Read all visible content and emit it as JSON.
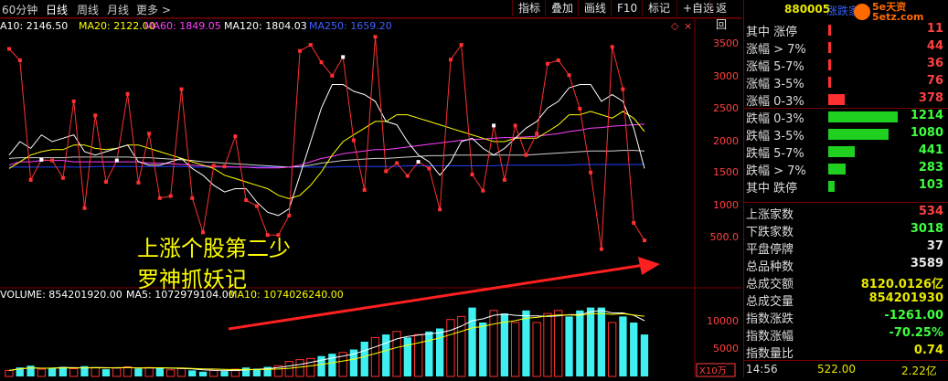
{
  "toolbar": {
    "tabs": [
      "60分钟",
      "日线",
      "周线",
      "月线",
      "更多 >"
    ],
    "active_tab": "日线",
    "buttons": [
      "指标",
      "叠加",
      "画线",
      "F10",
      "标记",
      "+自选",
      "返回"
    ]
  },
  "ma_legend": {
    "ma10": "A10: 2146.50",
    "ma20": "MA20: 2122.00",
    "ma60": "MA60: 1849.05",
    "ma120": "MA120: 1804.03",
    "ma250": "MA250: 1659.20",
    "colors": {
      "ma10": "#ffffff",
      "ma20": "#ffff00",
      "ma60": "#ff40ff",
      "ma120": "#ffffff",
      "ma250": "#2040ff"
    }
  },
  "vol_legend": {
    "volume": "VOLUME: 854201920.00",
    "ma5": "MA5: 1072979104.00",
    "ma10": "MA10: 1074026240.00"
  },
  "price_axis": [
    "3500",
    "3000",
    "2500",
    "2000",
    "1500",
    "1000",
    "500.0"
  ],
  "vol_axis": [
    "10000",
    "5000"
  ],
  "vol_unit": "X10万",
  "overlay": {
    "line1": "上涨个股第二少",
    "line2": "罗神抓妖记"
  },
  "right_panel": {
    "code": "880005",
    "name": "涨跌家数",
    "logo": "5e天资 5etz.com",
    "rows": [
      {
        "label": "其中 涨停",
        "value": "11",
        "color": "#ff3030",
        "bar": 0.005
      },
      {
        "label": "涨幅 > 7%",
        "value": "44",
        "color": "#ff3030",
        "bar": 0.01
      },
      {
        "label": "涨幅 5-7%",
        "value": "36",
        "color": "#ff3030",
        "bar": 0.01
      },
      {
        "label": "涨幅 3-5%",
        "value": "76",
        "color": "#ff3030",
        "bar": 0.015
      },
      {
        "label": "涨幅 0-3%",
        "value": "378",
        "color": "#ff3030",
        "bar": 0.22
      },
      {
        "label": "跌幅 0-3%",
        "value": "1214",
        "color": "#20d020",
        "bar": 0.95
      },
      {
        "label": "跌幅 3-5%",
        "value": "1080",
        "color": "#20d020",
        "bar": 0.82
      },
      {
        "label": "跌幅 5-7%",
        "value": "441",
        "color": "#20d020",
        "bar": 0.36
      },
      {
        "label": "跌幅 > 7%",
        "value": "283",
        "color": "#20d020",
        "bar": 0.24
      },
      {
        "label": "其中 跌停",
        "value": "103",
        "color": "#20d020",
        "bar": 0.09
      }
    ],
    "stats": [
      {
        "label": "上涨家数",
        "value": "534",
        "cls": "red"
      },
      {
        "label": "下跌家数",
        "value": "3018",
        "cls": "green"
      },
      {
        "label": "平盘停牌",
        "value": "37",
        "cls": "white"
      },
      {
        "label": "总品种数",
        "value": "3589",
        "cls": "white"
      },
      {
        "label": "总成交额",
        "value": "8120.0126亿",
        "cls": "yellow"
      },
      {
        "label": "总成交量",
        "value": "854201930",
        "cls": "yellow"
      },
      {
        "label": "指数涨跌",
        "value": "-1261.00",
        "cls": "green"
      },
      {
        "label": "指数涨幅",
        "value": "-70.25%",
        "cls": "green"
      },
      {
        "label": "指数量比",
        "value": "0.74",
        "cls": "yellow"
      }
    ],
    "footer": {
      "time": "14:56",
      "price": "522.00",
      "amount": "2.22亿"
    }
  },
  "chart_data": {
    "type": "line",
    "ylim": [
      300,
      3700
    ],
    "price": [
      3380,
      3210,
      1430,
      1730,
      1720,
      1460,
      2600,
      1010,
      2390,
      1400,
      1720,
      2710,
      1390,
      2120,
      1160,
      1190,
      2780,
      1160,
      650,
      1640,
      1630,
      2080,
      1130,
      1040,
      610,
      610,
      900,
      3350,
      3440,
      3180,
      2980,
      3260,
      2020,
      1280,
      3560,
      1560,
      1680,
      1490,
      1700,
      1600,
      990,
      3220,
      3440,
      1510,
      1270,
      2240,
      1430,
      2240,
      1800,
      2120,
      3160,
      3210,
      2990,
      2490,
      1540,
      400,
      3410,
      2780,
      790,
      530
    ],
    "ma10": [
      1800,
      2000,
      1900,
      2100,
      2000,
      2050,
      2100,
      1850,
      1800,
      1850,
      1900,
      1950,
      1700,
      1650,
      1650,
      1700,
      1750,
      1600,
      1500,
      1350,
      1250,
      1300,
      1300,
      1100,
      950,
      900,
      1000,
      1500,
      2000,
      2500,
      2850,
      2850,
      2750,
      2700,
      2600,
      2300,
      2250,
      2000,
      1800,
      1700,
      1500,
      1700,
      2000,
      2050,
      1900,
      1800,
      1900,
      2050,
      2200,
      2300,
      2500,
      2600,
      2800,
      2850,
      2850,
      2600,
      2700,
      2600,
      2200,
      1600
    ],
    "ma20": [
      1600,
      1700,
      1800,
      1850,
      1880,
      1880,
      1950,
      1950,
      1900,
      1880,
      1900,
      1950,
      1950,
      1900,
      1850,
      1800,
      1750,
      1700,
      1650,
      1600,
      1500,
      1450,
      1400,
      1350,
      1300,
      1200,
      1150,
      1200,
      1350,
      1550,
      1800,
      2000,
      2100,
      2200,
      2300,
      2300,
      2400,
      2400,
      2350,
      2300,
      2250,
      2200,
      2150,
      2100,
      2050,
      2000,
      2000,
      2050,
      2050,
      2050,
      2150,
      2250,
      2400,
      2400,
      2450,
      2400,
      2350,
      2450,
      2350,
      2150
    ],
    "ma60": [
      1650,
      1700,
      1700,
      1720,
      1720,
      1720,
      1700,
      1700,
      1700,
      1700,
      1700,
      1700,
      1700,
      1680,
      1680,
      1670,
      1660,
      1650,
      1640,
      1630,
      1630,
      1620,
      1620,
      1610,
      1610,
      1610,
      1620,
      1650,
      1700,
      1750,
      1780,
      1820,
      1840,
      1860,
      1880,
      1880,
      1900,
      1920,
      1940,
      1960,
      1980,
      2000,
      2020,
      2030,
      2040,
      2050,
      2060,
      2060,
      2070,
      2080,
      2100,
      2120,
      2150,
      2170,
      2200,
      2210,
      2230,
      2240,
      2250,
      2260
    ],
    "ma120": [
      1750,
      1760,
      1760,
      1760,
      1760,
      1760,
      1770,
      1770,
      1770,
      1770,
      1770,
      1770,
      1760,
      1760,
      1750,
      1740,
      1730,
      1720,
      1700,
      1690,
      1680,
      1670,
      1660,
      1650,
      1640,
      1630,
      1620,
      1630,
      1650,
      1680,
      1700,
      1720,
      1730,
      1740,
      1750,
      1750,
      1760,
      1770,
      1780,
      1790,
      1790,
      1800,
      1800,
      1800,
      1800,
      1800,
      1800,
      1800,
      1800,
      1810,
      1820,
      1830,
      1840,
      1850,
      1860,
      1860,
      1860,
      1870,
      1870,
      1860
    ],
    "ma250": [
      1620,
      1620,
      1620,
      1620,
      1620,
      1620,
      1620,
      1620,
      1630,
      1630,
      1630,
      1630,
      1630,
      1630,
      1630,
      1630,
      1630,
      1620,
      1620,
      1620,
      1620,
      1620,
      1620,
      1620,
      1620,
      1620,
      1620,
      1620,
      1620,
      1620,
      1620,
      1630,
      1630,
      1630,
      1630,
      1630,
      1630,
      1640,
      1640,
      1640,
      1640,
      1640,
      1640,
      1640,
      1640,
      1640,
      1650,
      1650,
      1650,
      1650,
      1650,
      1650,
      1650,
      1660,
      1660,
      1660,
      1660,
      1660,
      1660,
      1660
    ],
    "volume": [
      3000,
      3500,
      3800,
      3200,
      3400,
      3600,
      3300,
      3700,
      3500,
      3200,
      3400,
      3600,
      3300,
      3500,
      3400,
      3100,
      3300,
      3000,
      2800,
      3000,
      2900,
      3200,
      3500,
      3300,
      3600,
      3800,
      4500,
      4800,
      5000,
      5400,
      5800,
      6000,
      6500,
      7800,
      8500,
      9000,
      9500,
      8500,
      9000,
      9500,
      10000,
      11500,
      12000,
      13500,
      11000,
      13000,
      12500,
      11000,
      13000,
      11000,
      12500,
      13000,
      12000,
      13000,
      13500,
      13500,
      11000,
      12000,
      11000,
      9000
    ],
    "volume_ylim": [
      2000,
      14500
    ]
  }
}
